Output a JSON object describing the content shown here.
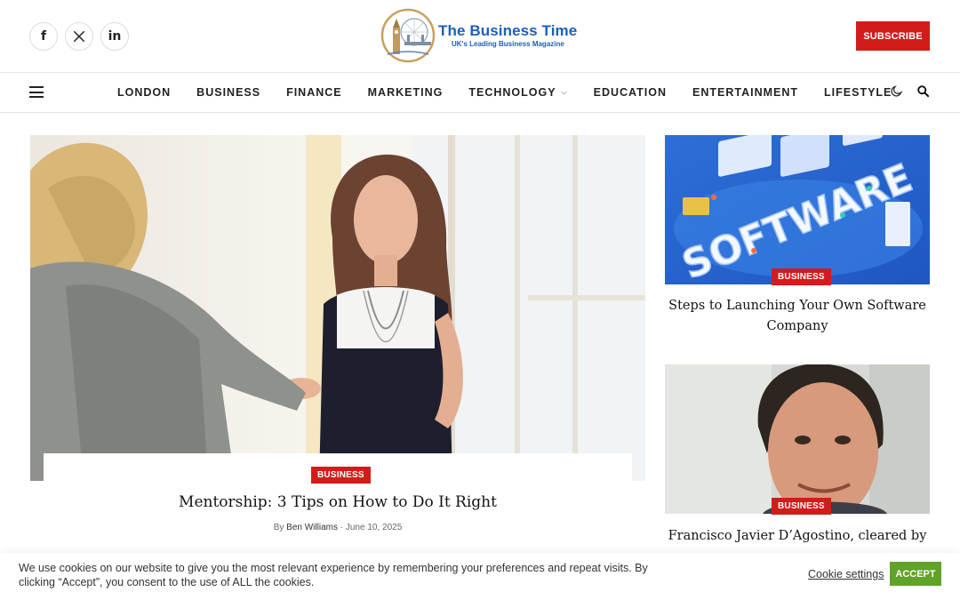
{
  "header": {
    "social": [
      {
        "icon": "facebook-icon",
        "glyph": "f"
      },
      {
        "icon": "x-icon",
        "glyph": "𝕏"
      },
      {
        "icon": "linkedin-icon",
        "glyph": "in"
      }
    ],
    "logo_title": "The Business Time",
    "logo_tagline": "UK's Leading Business Magazine",
    "subscribe_label": "SUBSCRIBE"
  },
  "nav": {
    "items": [
      {
        "label": "LONDON",
        "dropdown": false
      },
      {
        "label": "BUSINESS",
        "dropdown": false
      },
      {
        "label": "FINANCE",
        "dropdown": false
      },
      {
        "label": "MARKETING",
        "dropdown": false
      },
      {
        "label": "TECHNOLOGY",
        "dropdown": true
      },
      {
        "label": "EDUCATION",
        "dropdown": false
      },
      {
        "label": "ENTERTAINMENT",
        "dropdown": false
      },
      {
        "label": "LIFESTYLE",
        "dropdown": true
      }
    ],
    "right_icons": [
      "moon-icon",
      "search-icon"
    ]
  },
  "featured": {
    "category": "BUSINESS",
    "title": "Mentorship: 3 Tips on How to Do It Right",
    "by": "By",
    "author": "Ben Williams",
    "separator": "·",
    "date": "June 10, 2025"
  },
  "side_posts": [
    {
      "category": "BUSINESS",
      "title": "Steps to Launching Your Own Software Company",
      "image_text": "SOFTWARE"
    },
    {
      "category": "BUSINESS",
      "title": "Francisco Javier D’Agostino, cleared by"
    }
  ],
  "cookie": {
    "text": "We use cookies on our website to give you the most relevant experience by remembering your preferences and repeat visits. By clicking “Accept”, you consent to the use of ALL the cookies.",
    "settings_label": "Cookie settings",
    "accept_label": "ACCEPT"
  },
  "colors": {
    "accent_red": "#d21c1c",
    "logo_blue": "#1d5fb8",
    "accept_green": "#61a229"
  }
}
